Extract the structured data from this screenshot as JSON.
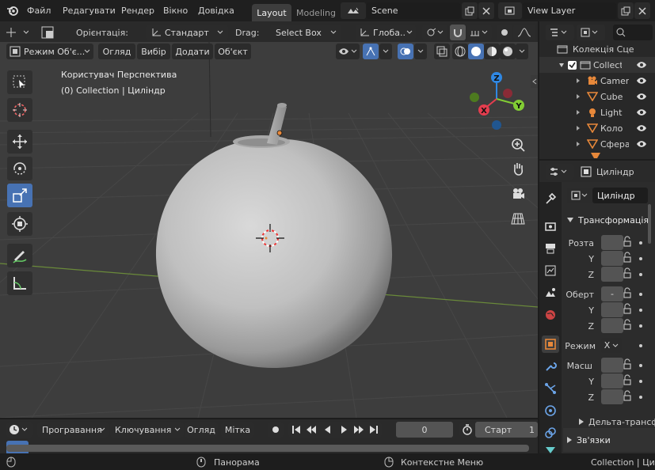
{
  "topbar": {
    "menus": [
      "Файл",
      "Редагувати",
      "Рендер",
      "Вікно",
      "Довідка"
    ],
    "workspaces": [
      "Layout",
      "Modeling"
    ],
    "scene_value": "Scene",
    "view_layer_value": "View Layer"
  },
  "viewport_header": {
    "orientation_label": "Орієнтація:",
    "orientation_value": "Стандарт",
    "drag_label": "Drag:",
    "drag_value": "Select Box",
    "transform_value": "Глоба..",
    "mode_value": "Режим Об'є...",
    "menus": [
      "Огляд",
      "Вибір",
      "Додати",
      "Об'єкт"
    ]
  },
  "viewport": {
    "view_name": "Користувач Перспектива",
    "object_info": "(0) Collection | Циліндр",
    "gizmo_axes": {
      "x": "X",
      "y": "Y",
      "z": "Z"
    }
  },
  "outliner": {
    "scene_collection": "Колекція Сце",
    "items": [
      {
        "label": "Collect",
        "icon": "collection-icon"
      },
      {
        "label": "Camer",
        "icon": "camera-icon"
      },
      {
        "label": "Cube",
        "icon": "mesh-icon"
      },
      {
        "label": "Light",
        "icon": "light-icon"
      },
      {
        "label": "Коло",
        "icon": "mesh-icon"
      },
      {
        "label": "Сфера",
        "icon": "mesh-icon"
      }
    ]
  },
  "properties": {
    "object_name_header": "Циліндр",
    "object_name_field": "Циліндр",
    "panel_transform": "Трансформація",
    "location_label": "Розта",
    "rotation_label": "Оберт",
    "rotation_value": "-",
    "mode_label": "Режим",
    "mode_value": "X",
    "scale_label": "Масш",
    "axis_y": "Y",
    "axis_z": "Z",
    "delta_label": "Дельта-трансф",
    "relations_label": "Зв'язки"
  },
  "timeline": {
    "menus": [
      "Програвання",
      "Ключування",
      "Огляд",
      "Мітка"
    ],
    "current_frame": "0",
    "start_label": "Старт",
    "start_value": "1"
  },
  "statusbar": {
    "pan": "Панорама",
    "context_menu": "Контекстне Меню",
    "info": "Collection | Цилі"
  },
  "colors": {
    "accent": "#4772b3",
    "axis_x": "#e43d4e",
    "axis_y": "#82cd34",
    "axis_z": "#2f88e4",
    "object_orange": "#e7883a"
  }
}
